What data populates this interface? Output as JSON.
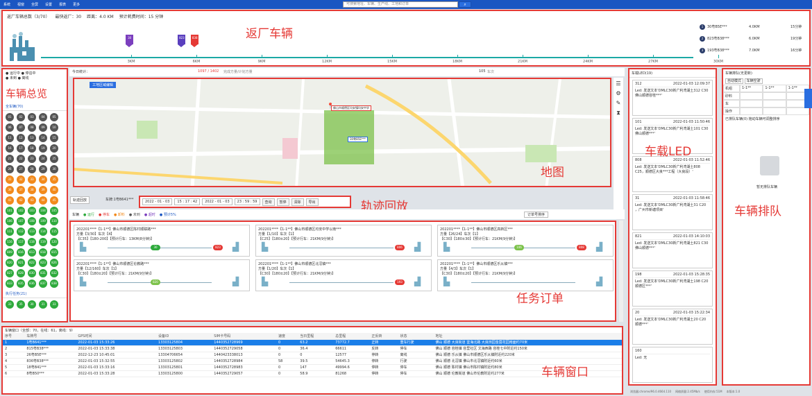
{
  "topbar": {
    "menus": [
      "系统",
      "视窗",
      "全屏",
      "设置",
      "报表",
      "更多"
    ],
    "search_placeholder": "可搜索地址、车辆、生产线、工地和订单",
    "search_icon": "search-icon"
  },
  "returnbar": {
    "summary": "返厂车辆总数（3/70）",
    "nearest": "最快返厂：30",
    "distance": "距离：4.0 KM",
    "eta": "预计耗费时间：15 分钟",
    "label": "返厂车辆",
    "ticks": [
      "3KM",
      "6KM",
      "9KM",
      "12KM",
      "15KM",
      "18KM",
      "21KM",
      "24KM",
      "27KM",
      "30KM"
    ],
    "trucks": [
      {
        "text": "30",
        "color": "#7b3fbe",
        "pos": 0.13
      },
      {
        "text": "823",
        "color": "#5a3fbe",
        "pos": 0.21
      },
      {
        "text": "838",
        "color": "#e53935",
        "pos": 0.23
      }
    ],
    "list": [
      {
        "n": "1",
        "plate": "30粤B5E***",
        "dist": "4.0KM",
        "eta": "15分钟"
      },
      {
        "n": "2",
        "plate": "823粤B38***",
        "dist": "6.0KM",
        "eta": "19分钟"
      },
      {
        "n": "3",
        "plate": "193粤B38***",
        "dist": "7.0KM",
        "eta": "16分钟"
      }
    ]
  },
  "left": {
    "legend1": "运行中",
    "legend2": "停泊中",
    "legend3": "未到",
    "legend4": "离线",
    "overlay": "车辆总览",
    "group1": "全车辆(70)",
    "group2": "执行任务(21)",
    "dots": [
      [
        "01",
        "02",
        "03",
        "04",
        "05",
        "gray"
      ],
      [
        "06",
        "07",
        "08",
        "09",
        "10",
        "gray"
      ],
      [
        "11",
        "12",
        "13",
        "14",
        "15",
        "gray"
      ],
      [
        "16",
        "17",
        "18",
        "19",
        "20",
        "gray"
      ],
      [
        "21",
        "22",
        "23",
        "24",
        "25",
        "gray"
      ],
      [
        "26",
        "27",
        "28",
        "29",
        "30",
        "gray"
      ],
      [
        "31",
        "32",
        "33",
        "34",
        "35",
        "orange"
      ],
      [
        "36",
        "37",
        "38",
        "39",
        "40",
        "orange"
      ],
      [
        "41",
        "42",
        "43",
        "44",
        "45",
        "orange"
      ],
      [
        "101",
        "102",
        "103",
        "104",
        "105",
        "green"
      ],
      [
        "106",
        "107",
        "108",
        "109",
        "110",
        "green"
      ],
      [
        "111",
        "112",
        "113",
        "114",
        "115",
        "green"
      ],
      [
        "116",
        "117",
        "118",
        "119",
        "120",
        "green"
      ],
      [
        "809",
        "816",
        "813",
        "818",
        "815",
        "green"
      ],
      [
        "820",
        "821",
        "822",
        "823",
        "826",
        "green"
      ],
      [
        "827",
        "828",
        "830",
        "831",
        "832",
        "green"
      ],
      [
        "833",
        "835",
        "836",
        "837",
        "838",
        "green"
      ]
    ],
    "dots2": [
      "33",
      "35",
      "30",
      "31",
      "33"
    ]
  },
  "mapstat": {
    "left": "今日统计：",
    "count": "1097 / 1402",
    "countlabel": "完成方量/计划方量",
    "mid": "105",
    "midlabel": "车次"
  },
  "map": {
    "label": "地图",
    "tag": "工地区域编辑",
    "popup": "佛山市顺德区均安镇均安中学",
    "car": "30粤B5E***"
  },
  "route": {
    "label": "轨迹回放",
    "mode": "轨迹回放",
    "plate": "车牌:1粤B641***",
    "d1": "2022 - 01 - 03",
    "t1": "15 : 17 : 42",
    "d2": "2022 - 01 - 03",
    "t2": "23 : 59 : 59",
    "btns": [
      "查询",
      "暂停",
      "清除",
      "导出"
    ]
  },
  "orderbar": {
    "items": [
      "车辆",
      "运行",
      "停车",
      "卸料",
      "未到",
      "超时",
      "预计5%"
    ],
    "sort": "订单号排序"
  },
  "orders": {
    "label": "任务订单",
    "cards": [
      {
        "l1": "202201****【1-1**】佛山市顺德区陈村顺联路***",
        "l2": "方量【3/30】车次【4】",
        "l3": "【C35】【180-200】【预计行车：13KM(8分钟)】",
        "b1": "30",
        "b2": "823",
        "b1c": "#2eaa3c",
        "b2c": "#e53935"
      },
      {
        "l1": "202201****【1-1**】佛山市顺德区均安中学以南***",
        "l2": "方量【1/10】车次【1】",
        "l3": "【C25】【180±20】【预计行车：21KM(9分钟)】",
        "b1": "",
        "b2": "806",
        "b1c": "#2eaa3c",
        "b2c": "#e53935"
      },
      {
        "l1": "202201****【1-1**】佛山市顺德区高新区***",
        "l2": "方量【26/24】车次【1】",
        "l3": "【C30】【180±30】【预计行车：21KM(9分钟)】",
        "b1": "106",
        "b2": "808",
        "b1c": "#7cc24a",
        "b2c": "#e53935"
      },
      {
        "l1": "202201****【1-1**】佛山市顺德区伦教路***",
        "l2": "方量【12/160】车次【1】",
        "l3": "【C30】【180±20】【预计行车：21KM(9分钟)】",
        "b1": "820",
        "b2": "",
        "b1c": "#7cc24a",
        "b2c": "#e53935"
      },
      {
        "l1": "202201****【1-1**】佛山市顺德区北滘镇***",
        "l2": "方量【1/20】车次【1】",
        "l3": "【C30】【180±20】【预计行车：21KM(9分钟)】",
        "b1": "",
        "b2": "193",
        "b1c": "#7cc24a",
        "b2c": "#e53935"
      },
      {
        "l1": "202201****【1-1**】佛山市顺德区乐从镇***",
        "l2": "方量【4/3】车次【1】",
        "l3": "【C30】【180±20】【预计行车：21KM(9分钟)】",
        "b1": "",
        "b2": "",
        "b1c": "#7cc24a",
        "b2c": "#e53935"
      }
    ]
  },
  "vwin": {
    "caption": "车辆窗口（全部：70，在线：61，离线：9）",
    "label": "车辆窗口",
    "cols": [
      "序号",
      "车牌号",
      "GPS时间",
      "设备ID",
      "SIM卡号码",
      "速度",
      "当日里程",
      "总里程",
      "正反转",
      "状态",
      "地址"
    ],
    "rows": [
      [
        "1",
        "1粤B641***",
        "2022-01-03 15:33:26",
        "13303125804",
        "1440352728969",
        "0",
        "63.2",
        "73772.7",
        "正转",
        "重车行驶",
        "佛山 顺德 大良街道 鉴海北路 大良田园金茵花园南面约70米"
      ],
      [
        "2",
        "815粤B38***",
        "2022-01-03 15:33:38",
        "13303125803",
        "1440352729058",
        "0",
        "36.4",
        "66611",
        "反转",
        "停车",
        "佛山 顺德 容桂镇 容里社区 文海西路 容桂七中附近约150米"
      ],
      [
        "3",
        "26粤B5E***",
        "2022-12-23 10:45:01",
        "13304706654",
        "1440423338013",
        "0",
        "0",
        "12577",
        "停转",
        "离线",
        "佛山 顺德 乐从镇 佛山市顺德区乐从镇附近约220米"
      ],
      [
        "4",
        "836粤B38***",
        "2022-01-03 15:32:55",
        "13303125802",
        "1440352728984",
        "58",
        "39.5",
        "54645.3",
        "停转",
        "行驶",
        "佛山 顺德 北滘镇 佛山市北滘镇附近约60米"
      ],
      [
        "5",
        "18粤B41***",
        "2022-01-03 15:33:16",
        "13303125801",
        "1440352728983",
        "0",
        "147",
        "49994.6",
        "停转",
        "停车",
        "佛山 顺德 陈村镇 佛山市陈村镇附近约80米"
      ],
      [
        "6",
        "8粤B50***",
        "2022-01-03 15:33:28",
        "13303125800",
        "1440352729057",
        "0",
        "58.9",
        "81268",
        "停转",
        "停车",
        "佛山 顺德 伦教街道 佛山市伦教附近约277米"
      ]
    ]
  },
  "led": {
    "title": "车载LED",
    "search": "车载LED(19)",
    "cards": [
      {
        "id": "312",
        "time": "2022-01-03 12:09:37",
        "text": "Led: 发送文本'DMLC30新广利湾湖土312 C30  佛山顺德容桂***'"
      },
      {
        "id": "101",
        "time": "2022-01-03 11:50:46",
        "text": "Led: 发送文本'DMLC30新广利湾湖土101 C30 佛山顺德***'"
      },
      {
        "id": "808",
        "time": "2022-01-03 11:52:46",
        "text": "Led: 发送文本'DMLC30新广利湾湖土808 C25，顺德区大良***工程（大良段）'"
      },
      {
        "id": "31",
        "time": "2022-01-03 11:58:46",
        "text": "Led: 发送文本'DMLC30新广利湾湖土31 C20 ，广州市新塘项目'"
      },
      {
        "id": "821",
        "time": "2022-01-03 14:10:03",
        "text": "Led: 发送文本'DMLC30新广利湾湖土821 C30 佛山顺德***'"
      },
      {
        "id": "198",
        "time": "2022-01-03 15:28:35",
        "text": "Led: 发送文本'DMLC30新广利湾湖土198 C20 顺德区***'"
      },
      {
        "id": "20",
        "time": "2022-01-03 15:22:34",
        "text": "Led: 发送文本'DMLC30新广利湾湖土20 C20 顺德***'"
      },
      {
        "id": "160",
        "time": "",
        "text": "Led: 无"
      }
    ]
  },
  "queue": {
    "title": "车辆排队",
    "head": "车辆排队(无更新)",
    "btn1": "自动模式",
    "btn2": "车辆空驶",
    "rows": [
      [
        "机组",
        "1-1**",
        "1-1**",
        "1-1**"
      ],
      [
        "砂料",
        "",
        "",
        ""
      ],
      [
        "车",
        "",
        "",
        ""
      ],
      [
        "操作",
        "",
        "",
        ""
      ]
    ],
    "sub": "已排队车辆(0) 拖动车辆可调整排序",
    "empty": "暂无排队车辆"
  },
  "status": [
    "浏览器:chrome/96.0.4664.110",
    "网络质量:2.45Mb/s",
    "使用内存:51M",
    "本版本:1.0"
  ]
}
